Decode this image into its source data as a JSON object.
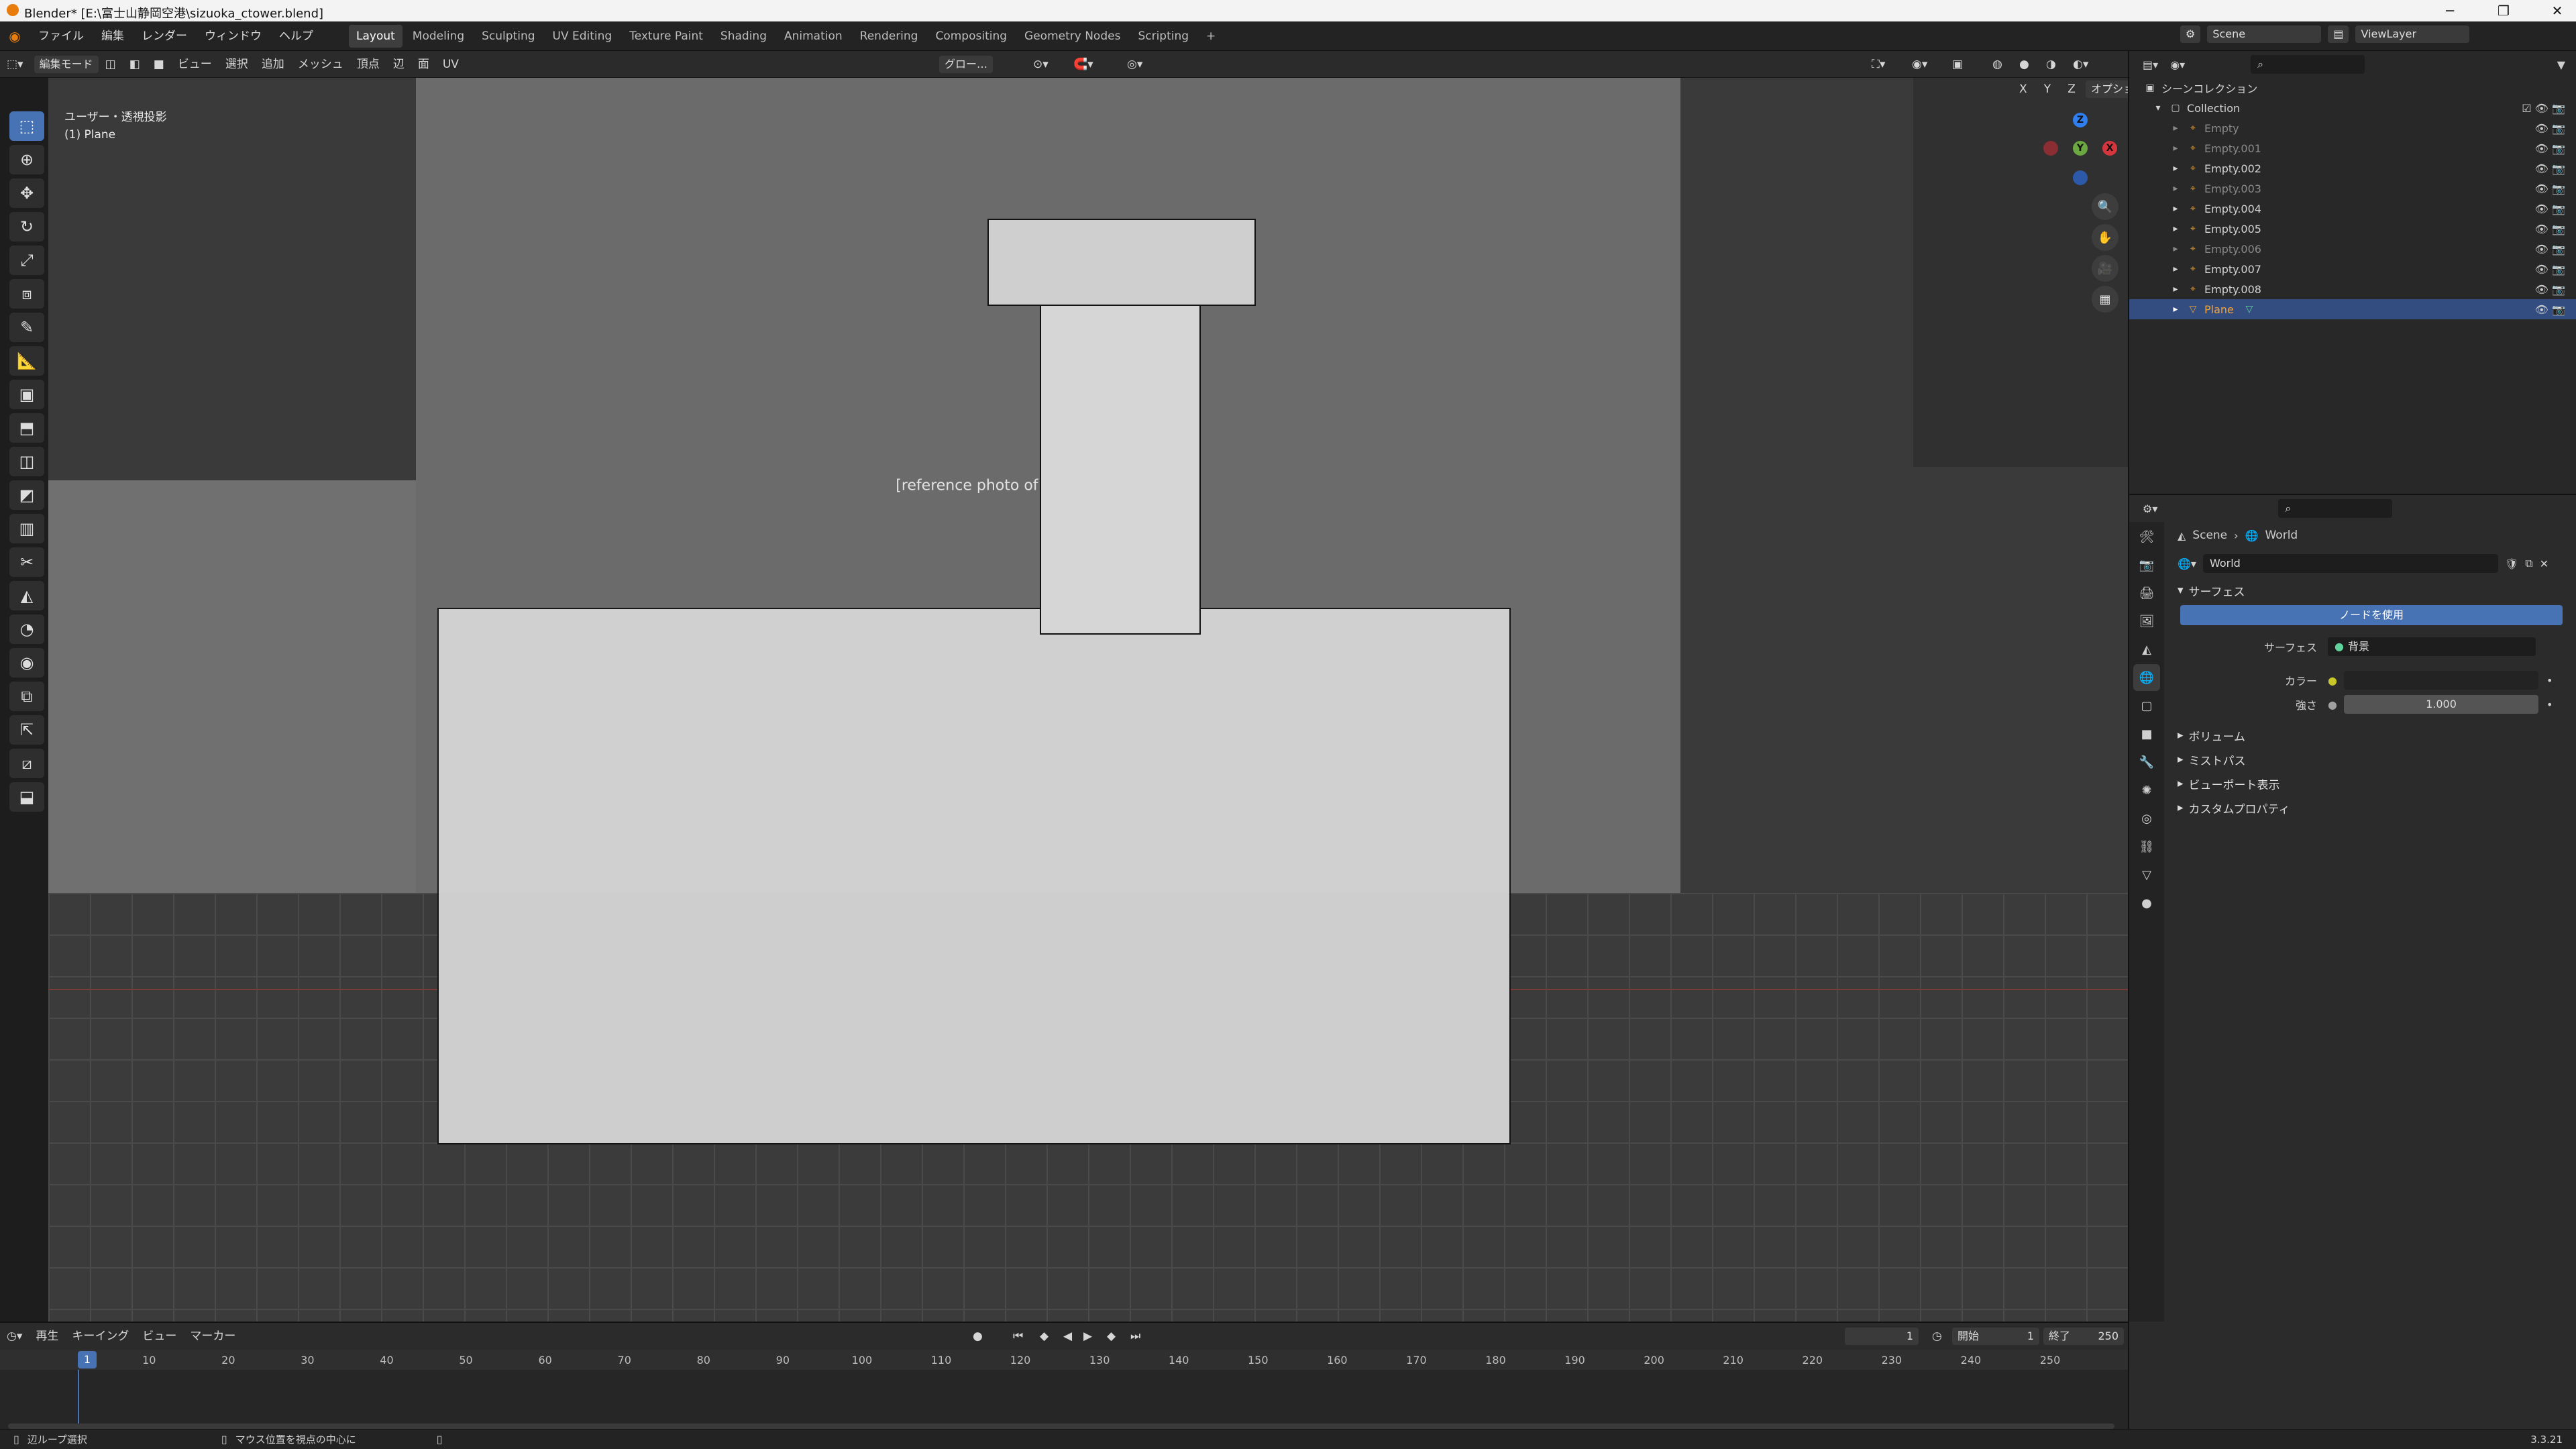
{
  "window": {
    "title": "Blender* [E:\\富士山静岡空港\\sizuoka_ctower.blend]"
  },
  "menu": [
    "ファイル",
    "編集",
    "レンダー",
    "ウィンドウ",
    "ヘルプ"
  ],
  "workspaces": [
    "Layout",
    "Modeling",
    "Sculpting",
    "UV Editing",
    "Texture Paint",
    "Shading",
    "Animation",
    "Rendering",
    "Compositing",
    "Geometry Nodes",
    "Scripting"
  ],
  "active_workspace": "Layout",
  "scene": {
    "name": "Scene",
    "view_layer": "ViewLayer"
  },
  "viewport_header": {
    "mode": "編集モード",
    "menus": [
      "ビュー",
      "選択",
      "追加",
      "メッシュ",
      "頂点",
      "辺",
      "面",
      "UV"
    ],
    "transform_orientation": "グロー…",
    "options": "オプション",
    "axes": [
      "X",
      "Y",
      "Z"
    ]
  },
  "viewport": {
    "view_label": "ユーザー・透視投影",
    "object_label": "(1) Plane",
    "image_placeholder": "[reference photo of airport control tower]"
  },
  "outliner": {
    "root": "シーンコレクション",
    "collection": "Collection",
    "items": [
      {
        "name": "Empty",
        "dim": true
      },
      {
        "name": "Empty.001",
        "dim": true
      },
      {
        "name": "Empty.002",
        "dim": false
      },
      {
        "name": "Empty.003",
        "dim": true
      },
      {
        "name": "Empty.004",
        "dim": false
      },
      {
        "name": "Empty.005",
        "dim": false
      },
      {
        "name": "Empty.006",
        "dim": true
      },
      {
        "name": "Empty.007",
        "dim": false
      },
      {
        "name": "Empty.008",
        "dim": false
      },
      {
        "name": "Plane",
        "dim": false,
        "selected": true
      }
    ]
  },
  "properties": {
    "breadcrumb": [
      "Scene",
      "World"
    ],
    "world_name": "World",
    "surface_panel": "サーフェス",
    "use_nodes": "ノードを使用",
    "surface_label": "サーフェス",
    "surface_value": "背景",
    "color_label": "カラー",
    "strength_label": "強さ",
    "strength_value": "1.000",
    "panels": [
      "ボリューム",
      "ミストパス",
      "ビューポート表示",
      "カスタムプロパティ"
    ]
  },
  "timeline": {
    "menus": [
      "再生",
      "キーイング",
      "ビュー",
      "マーカー"
    ],
    "current_frame": "1",
    "start_label": "開始",
    "start_value": "1",
    "end_label": "終了",
    "end_value": "250",
    "ticks": [
      "1",
      "10",
      "20",
      "30",
      "40",
      "50",
      "60",
      "70",
      "80",
      "90",
      "100",
      "110",
      "120",
      "130",
      "140",
      "150",
      "160",
      "170",
      "180",
      "190",
      "200",
      "210",
      "220",
      "230",
      "240",
      "250"
    ]
  },
  "statusbar": {
    "left": "辺ループ選択",
    "middle": "マウス位置を視点の中心に",
    "version": "3.3.21"
  }
}
